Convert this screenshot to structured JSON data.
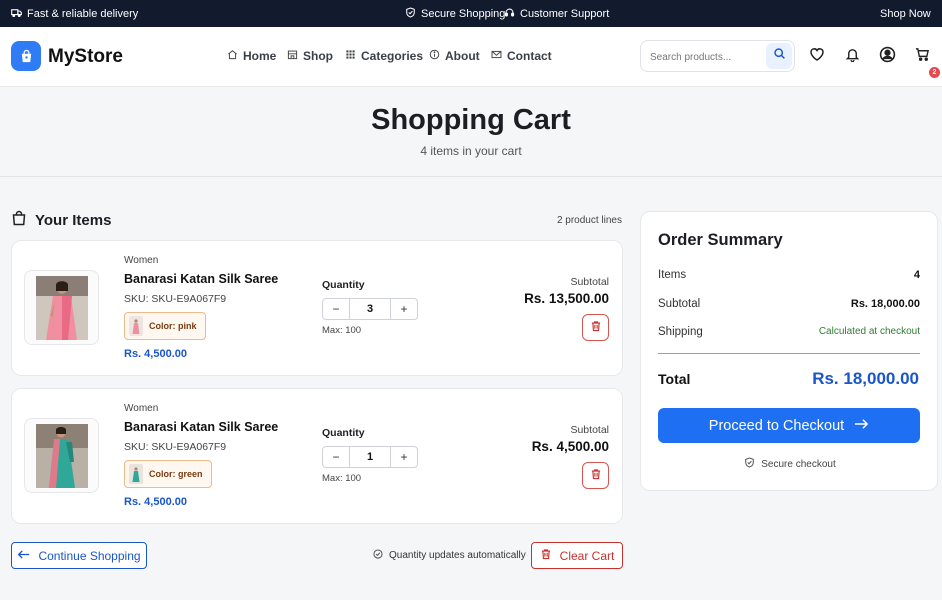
{
  "topbar": {
    "delivery": "Fast & reliable delivery",
    "secure": "Secure Shopping",
    "support": "Customer Support",
    "shop_now": "Shop Now"
  },
  "header": {
    "brand": "MyStore",
    "nav": [
      "Home",
      "Shop",
      "Categories",
      "About",
      "Contact"
    ],
    "search_placeholder": "Search products...",
    "cart_count": "2"
  },
  "hero": {
    "title": "Shopping Cart",
    "subtitle": "4 items in your cart"
  },
  "items_section": {
    "title": "Your Items",
    "product_lines": "2 product lines",
    "items": [
      {
        "category": "Women",
        "name": "Banarasi Katan Silk Saree",
        "sku": "SKU: SKU-E9A067F9",
        "color": "Color: pink",
        "price": "Rs. 4,500.00",
        "quantity_label": "Quantity",
        "quantity": "3",
        "max": "Max: 100",
        "subtotal_label": "Subtotal",
        "subtotal": "Rs. 13,500.00"
      },
      {
        "category": "Women",
        "name": "Banarasi Katan Silk Saree",
        "sku": "SKU: SKU-E9A067F9",
        "color": "Color: green",
        "price": "Rs. 4,500.00",
        "quantity_label": "Quantity",
        "quantity": "1",
        "max": "Max: 100",
        "subtotal_label": "Subtotal",
        "subtotal": "Rs. 4,500.00"
      }
    ]
  },
  "summary": {
    "title": "Order Summary",
    "items_label": "Items",
    "items_value": "4",
    "subtotal_label": "Subtotal",
    "subtotal_value": "Rs. 18,000.00",
    "shipping_label": "Shipping",
    "shipping_value": "Calculated at checkout",
    "total_label": "Total",
    "total_value": "Rs. 18,000.00",
    "checkout_label": "Proceed to Checkout",
    "secure_label": "Secure checkout"
  },
  "footer": {
    "continue_label": "Continue Shopping",
    "auto_update": "Quantity updates automatically",
    "clear_label": "Clear Cart"
  },
  "colors": {
    "primary": "#1e6ff2",
    "price_blue": "#1a56c9",
    "danger": "#c9302c",
    "topbar": "#121a2e",
    "success": "#2e7d32"
  }
}
